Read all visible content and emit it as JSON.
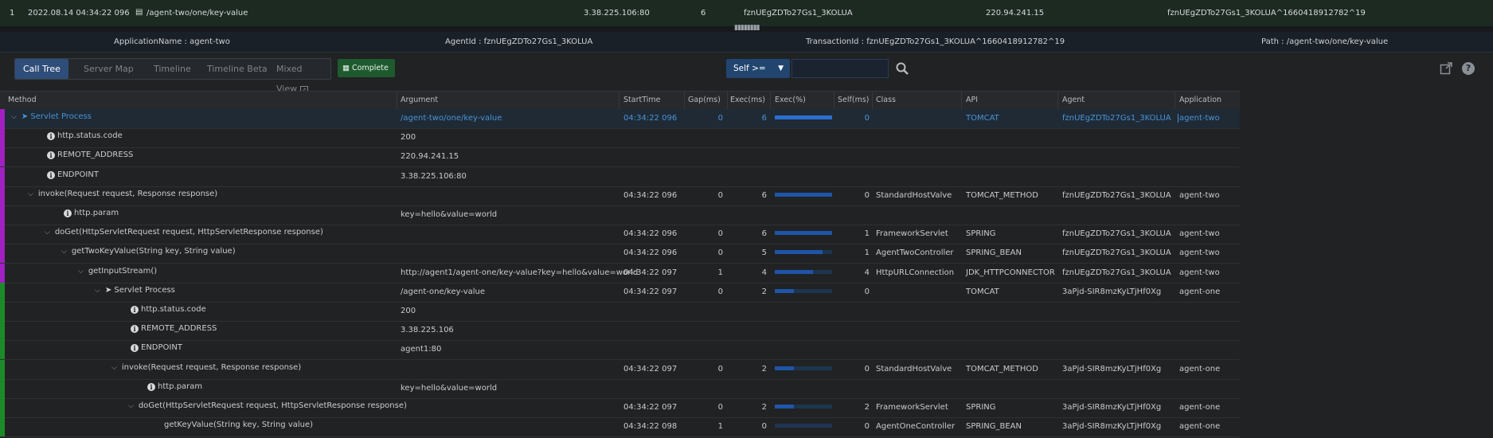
{
  "top_row": {
    "index": "1",
    "time": "2022.08.14 04:34:22 096",
    "path": "/agent-two/one/key-value",
    "endpoint": "3.38.225.106:80",
    "elapsed": "6",
    "agent": "fznUEgZDTo27Gs1_3KOLUA",
    "remote": "220.94.241.15",
    "transaction": "fznUEgZDTo27Gs1_3KOLUA^1660418912782^19"
  },
  "info_bar": {
    "application": "ApplicationName : agent-two",
    "agent": "AgentId : fznUEgZDTo27Gs1_3KOLUA",
    "transaction": "TransactionId : fznUEgZDTo27Gs1_3KOLUA^1660418912782^19",
    "path": "Path : /agent-two/one/key-value"
  },
  "toolbar": {
    "tabs": [
      "Call Tree",
      "Server Map",
      "Timeline",
      "Timeline Beta",
      "Mixed View"
    ],
    "complete_label": "Complete",
    "self_filter": "Self >=",
    "filter_value": ""
  },
  "columns": [
    "Method",
    "Argument",
    "StartTime",
    "Gap(ms)",
    "Exec(ms)",
    "Exec(%)",
    "Self(ms)",
    "Class",
    "API",
    "Agent",
    "Application"
  ],
  "colors": {
    "agent_two": "#a020c0",
    "agent_one": "#1d8a2a",
    "selection": "#4a93d6",
    "bar": "#1e55a8"
  },
  "rows": [
    {
      "depth": 0,
      "kind": "root",
      "method": "Servlet Process",
      "argument": "/agent-two/one/key-value",
      "start": "04:34:22 096",
      "gap": "0",
      "exec": "6",
      "pct": 100,
      "self": "0",
      "class": "",
      "api": "TOMCAT",
      "agent": "fznUEgZDTo27Gs1_3KOLUA",
      "app": "agent-two",
      "owner": "two",
      "selected": true
    },
    {
      "depth": 1,
      "kind": "info",
      "method": "http.status.code",
      "argument": "200",
      "start": "",
      "gap": "",
      "exec": "",
      "pct": null,
      "self": "",
      "class": "",
      "api": "",
      "agent": "",
      "app": "",
      "owner": "two"
    },
    {
      "depth": 1,
      "kind": "info",
      "method": "REMOTE_ADDRESS",
      "argument": "220.94.241.15",
      "start": "",
      "gap": "",
      "exec": "",
      "pct": null,
      "self": "",
      "class": "",
      "api": "",
      "agent": "",
      "app": "",
      "owner": "two"
    },
    {
      "depth": 1,
      "kind": "info",
      "method": "ENDPOINT",
      "argument": "3.38.225.106:80",
      "start": "",
      "gap": "",
      "exec": "",
      "pct": null,
      "self": "",
      "class": "",
      "api": "",
      "agent": "",
      "app": "",
      "owner": "two"
    },
    {
      "depth": 1,
      "kind": "node",
      "method": "invoke(Request request, Response response)",
      "argument": "",
      "start": "04:34:22 096",
      "gap": "0",
      "exec": "6",
      "pct": 100,
      "self": "0",
      "class": "StandardHostValve",
      "api": "TOMCAT_METHOD",
      "agent": "fznUEgZDTo27Gs1_3KOLUA",
      "app": "agent-two",
      "owner": "two"
    },
    {
      "depth": 2,
      "kind": "info",
      "method": "http.param",
      "argument": "key=hello&value=world",
      "start": "",
      "gap": "",
      "exec": "",
      "pct": null,
      "self": "",
      "class": "",
      "api": "",
      "agent": "",
      "app": "",
      "owner": "two"
    },
    {
      "depth": 2,
      "kind": "node",
      "method": "doGet(HttpServletRequest request, HttpServletResponse response)",
      "argument": "",
      "start": "04:34:22 096",
      "gap": "0",
      "exec": "6",
      "pct": 100,
      "self": "1",
      "class": "FrameworkServlet",
      "api": "SPRING",
      "agent": "fznUEgZDTo27Gs1_3KOLUA",
      "app": "agent-two",
      "owner": "two"
    },
    {
      "depth": 3,
      "kind": "node",
      "method": "getTwoKeyValue(String key, String value)",
      "argument": "",
      "start": "04:34:22 096",
      "gap": "0",
      "exec": "5",
      "pct": 83,
      "self": "1",
      "class": "AgentTwoController",
      "api": "SPRING_BEAN",
      "agent": "fznUEgZDTo27Gs1_3KOLUA",
      "app": "agent-two",
      "owner": "two"
    },
    {
      "depth": 4,
      "kind": "node",
      "method": "getInputStream()",
      "argument": "http://agent1/agent-one/key-value?key=hello&value=world",
      "start": "04:34:22 097",
      "gap": "1",
      "exec": "4",
      "pct": 67,
      "self": "4",
      "class": "HttpURLConnection",
      "api": "JDK_HTTPCONNECTOR",
      "agent": "fznUEgZDTo27Gs1_3KOLUA",
      "app": "agent-two",
      "owner": "two"
    },
    {
      "depth": 5,
      "kind": "root",
      "method": "Servlet Process",
      "argument": "/agent-one/key-value",
      "start": "04:34:22 097",
      "gap": "0",
      "exec": "2",
      "pct": 33,
      "self": "0",
      "class": "",
      "api": "TOMCAT",
      "agent": "3aPjd-SIR8mzKyLTjHf0Xg",
      "app": "agent-one",
      "owner": "one"
    },
    {
      "depth": 6,
      "kind": "info",
      "method": "http.status.code",
      "argument": "200",
      "start": "",
      "gap": "",
      "exec": "",
      "pct": null,
      "self": "",
      "class": "",
      "api": "",
      "agent": "",
      "app": "",
      "owner": "one"
    },
    {
      "depth": 6,
      "kind": "info",
      "method": "REMOTE_ADDRESS",
      "argument": "3.38.225.106",
      "start": "",
      "gap": "",
      "exec": "",
      "pct": null,
      "self": "",
      "class": "",
      "api": "",
      "agent": "",
      "app": "",
      "owner": "one"
    },
    {
      "depth": 6,
      "kind": "info",
      "method": "ENDPOINT",
      "argument": "agent1:80",
      "start": "",
      "gap": "",
      "exec": "",
      "pct": null,
      "self": "",
      "class": "",
      "api": "",
      "agent": "",
      "app": "",
      "owner": "one"
    },
    {
      "depth": 6,
      "kind": "node",
      "method": "invoke(Request request, Response response)",
      "argument": "",
      "start": "04:34:22 097",
      "gap": "0",
      "exec": "2",
      "pct": 33,
      "self": "0",
      "class": "StandardHostValve",
      "api": "TOMCAT_METHOD",
      "agent": "3aPjd-SIR8mzKyLTjHf0Xg",
      "app": "agent-one",
      "owner": "one"
    },
    {
      "depth": 7,
      "kind": "info",
      "method": "http.param",
      "argument": "key=hello&value=world",
      "start": "",
      "gap": "",
      "exec": "",
      "pct": null,
      "self": "",
      "class": "",
      "api": "",
      "agent": "",
      "app": "",
      "owner": "one"
    },
    {
      "depth": 7,
      "kind": "node",
      "method": "doGet(HttpServletRequest request, HttpServletResponse response)",
      "argument": "",
      "start": "04:34:22 097",
      "gap": "0",
      "exec": "2",
      "pct": 33,
      "self": "2",
      "class": "FrameworkServlet",
      "api": "SPRING",
      "agent": "3aPjd-SIR8mzKyLTjHf0Xg",
      "app": "agent-one",
      "owner": "one"
    },
    {
      "depth": 8,
      "kind": "leaf",
      "method": "getKeyValue(String key, String value)",
      "argument": "",
      "start": "04:34:22 098",
      "gap": "1",
      "exec": "0",
      "pct": 0,
      "self": "0",
      "class": "AgentOneController",
      "api": "SPRING_BEAN",
      "agent": "3aPjd-SIR8mzKyLTjHf0Xg",
      "app": "agent-one",
      "owner": "one"
    }
  ]
}
